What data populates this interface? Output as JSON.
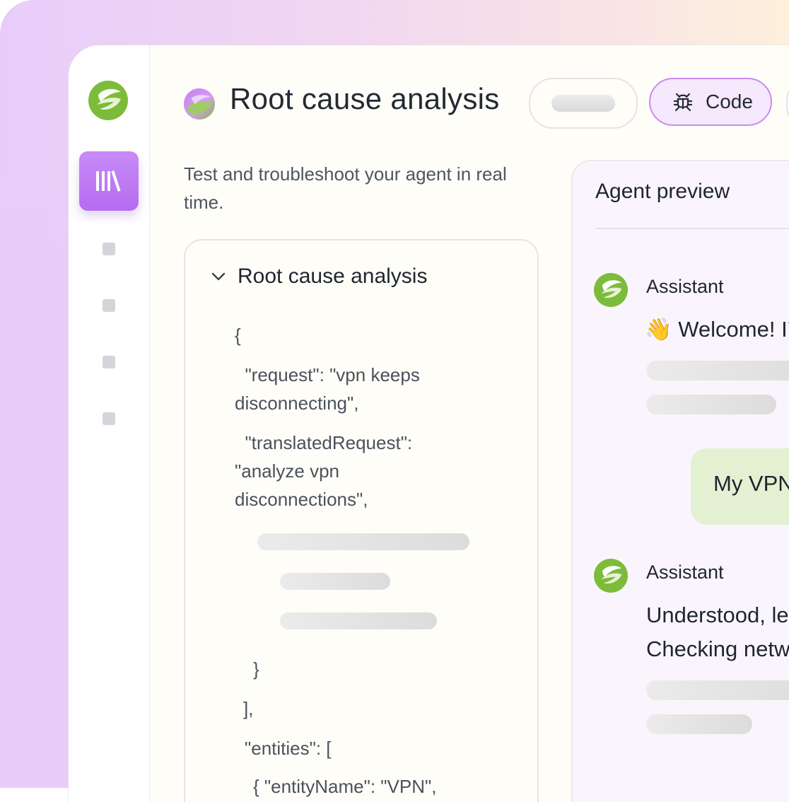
{
  "header": {
    "title": "Root cause analysis",
    "code_button_label": "Code"
  },
  "subtitle": "Test and troubleshoot your agent in real time.",
  "json_card": {
    "heading": "Root cause analysis",
    "lines": {
      "l1": "{",
      "l2": "  \"request\": \"vpn keeps",
      "l3": "disconnecting\",",
      "l4": "  \"translatedRequest\":",
      "l5": "\"analyze vpn",
      "l6": "disconnections\",",
      "l7": "}",
      "l8": "],",
      "l9": "\"entities\": [",
      "l10": "{ \"entityName\": \"VPN\","
    }
  },
  "preview": {
    "title": "Agent preview",
    "assistant_label": "Assistant",
    "welcome_message": "👋 Welcome! I’",
    "user_message": "My VPN",
    "reply_line1": "Understood, le",
    "reply_line2": "Checking netw"
  },
  "colors": {
    "accent_purple": "#b66cf1",
    "brand_green": "#7dbb3a",
    "user_bubble": "#e3f0d2"
  }
}
